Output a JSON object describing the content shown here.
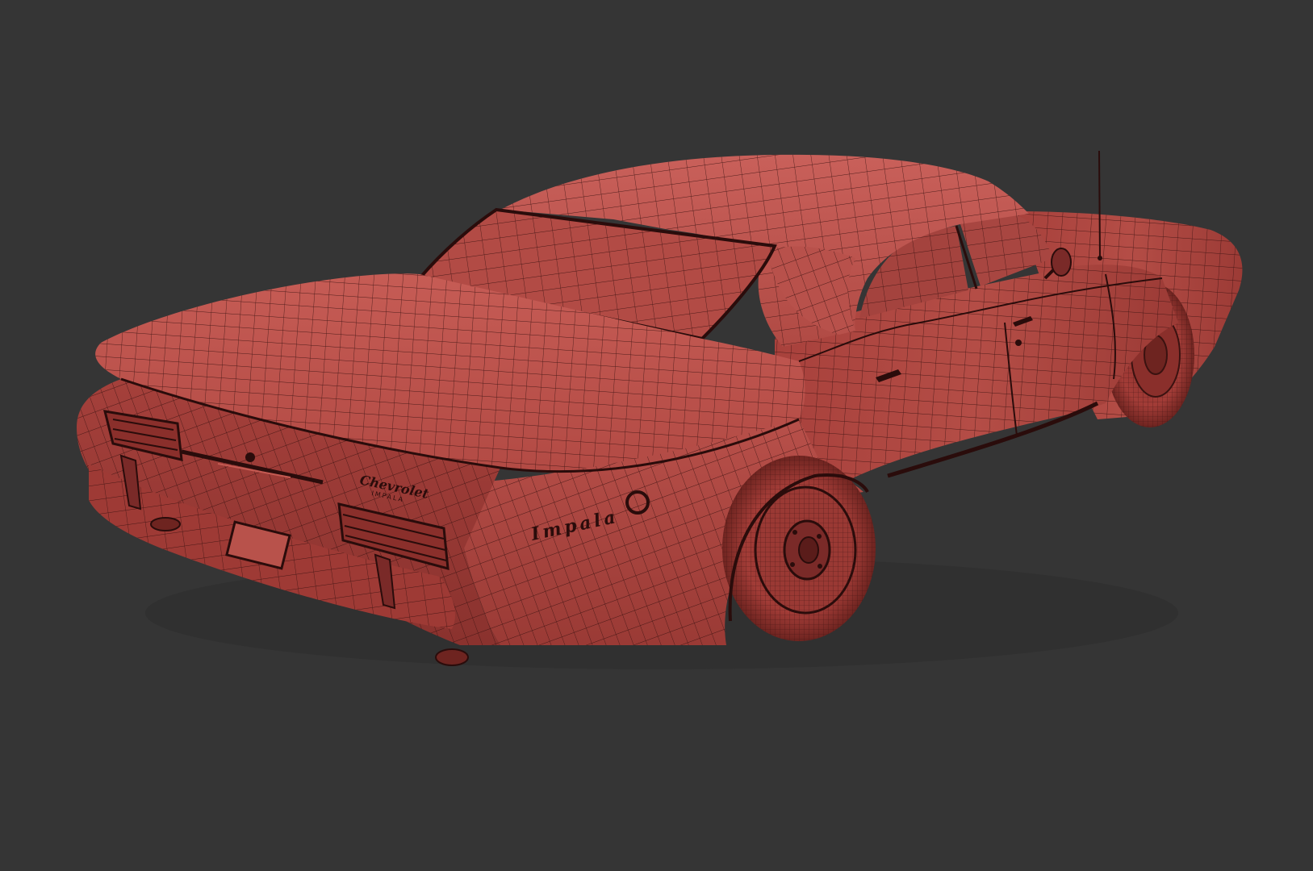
{
  "scene": {
    "background_color": "#353535",
    "subject": "wireframe-car-model",
    "colors": {
      "body": "#b04a44",
      "body_light": "#c45a52",
      "body_dark": "#7a2a28",
      "wire": "#3a1210",
      "shadow": "#2a0c0b"
    }
  },
  "emblems": {
    "side_badge": "Impala",
    "trunk_script": "Chevrolet",
    "trunk_sub": "IMPALA"
  }
}
